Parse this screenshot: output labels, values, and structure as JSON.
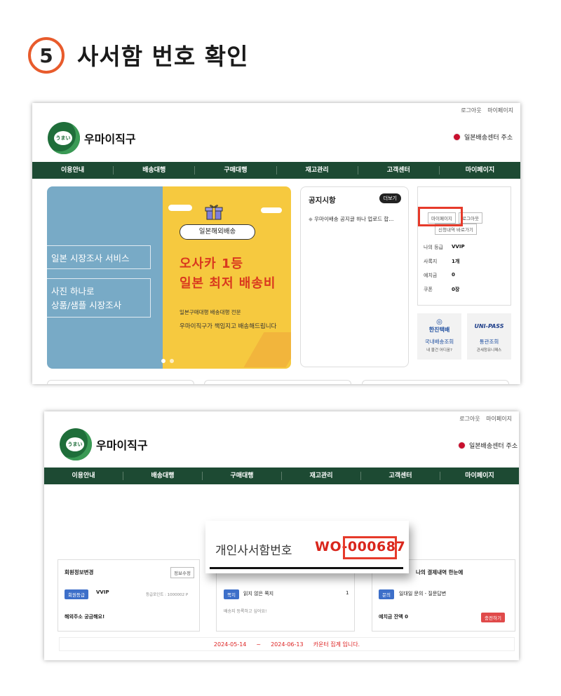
{
  "header": {
    "step_number": "5",
    "title": "사서함 번호 확인"
  },
  "site": {
    "top_links": [
      "로그아웃",
      "마이페이지"
    ],
    "logo_badge": "うまい",
    "logo_text": "우마이직구",
    "jp_center": "일본배송센터 주소",
    "nav": [
      "이용안내",
      "배송대행",
      "구매대행",
      "재고관리",
      "고객센터",
      "마이페이지"
    ]
  },
  "banner": {
    "left_box1": "일본 시장조사 서비스",
    "left_box2_line1": "사진 하나로",
    "left_box2_line2": "상품/샘플 시장조사",
    "pill": "일본해외배송",
    "headline1": "오사카 1등",
    "headline2": "일본 최저 배송비",
    "sub1": "일본구매대행 배송대행 전문",
    "sub2": "우마이직구가 책임지고 배송해드립니다"
  },
  "notice": {
    "title": "공지시항",
    "more": "더보기",
    "item": "우마이배송 공지글 하나 업로드 합..."
  },
  "my_panel": {
    "btn_mypage": "마이페이지",
    "btn_logout": "로그아웃",
    "btn_history": "신청내역 바로가기",
    "rows": [
      {
        "k": "나의 등급",
        "v": "VVIP"
      },
      {
        "k": "사록지",
        "v": "1개"
      },
      {
        "k": "예치금",
        "v": "0"
      },
      {
        "k": "쿠폰",
        "v": "0장"
      }
    ]
  },
  "tiles": [
    {
      "logo": "한진택배",
      "l1": "국내배송조회",
      "l2": "내 물건 어디꿈?"
    },
    {
      "logo": "UNI-PASS",
      "l1": "통관조회",
      "l2": "관세청유니패스"
    }
  ],
  "frame2": {
    "card1": {
      "title": "회원정보변경",
      "btn": "정보수정",
      "tag": "회원등급",
      "grade": "VVIP",
      "points": "등급포인트 : 1000002 P",
      "question": "해외주소 궁금해요!"
    },
    "card2": {
      "tag": "쪽지",
      "label": "읽지 않은 쪽지",
      "count": "1",
      "msg": "배송지 등록하고 싶어요!"
    },
    "card3": {
      "title": "나의 결제내역 한눈에",
      "tag": "문의",
      "label": "일대일 문의 - 질문답변",
      "balance": "예치금 잔액 0",
      "charge": "충전하기"
    },
    "date_from": "2024-05-14",
    "date_sep": "~",
    "date_to": "2024-06-13",
    "date_note": "카운터 집계 입니다."
  },
  "zoom": {
    "label": "개인사서함번호",
    "number": "WO-000687"
  }
}
